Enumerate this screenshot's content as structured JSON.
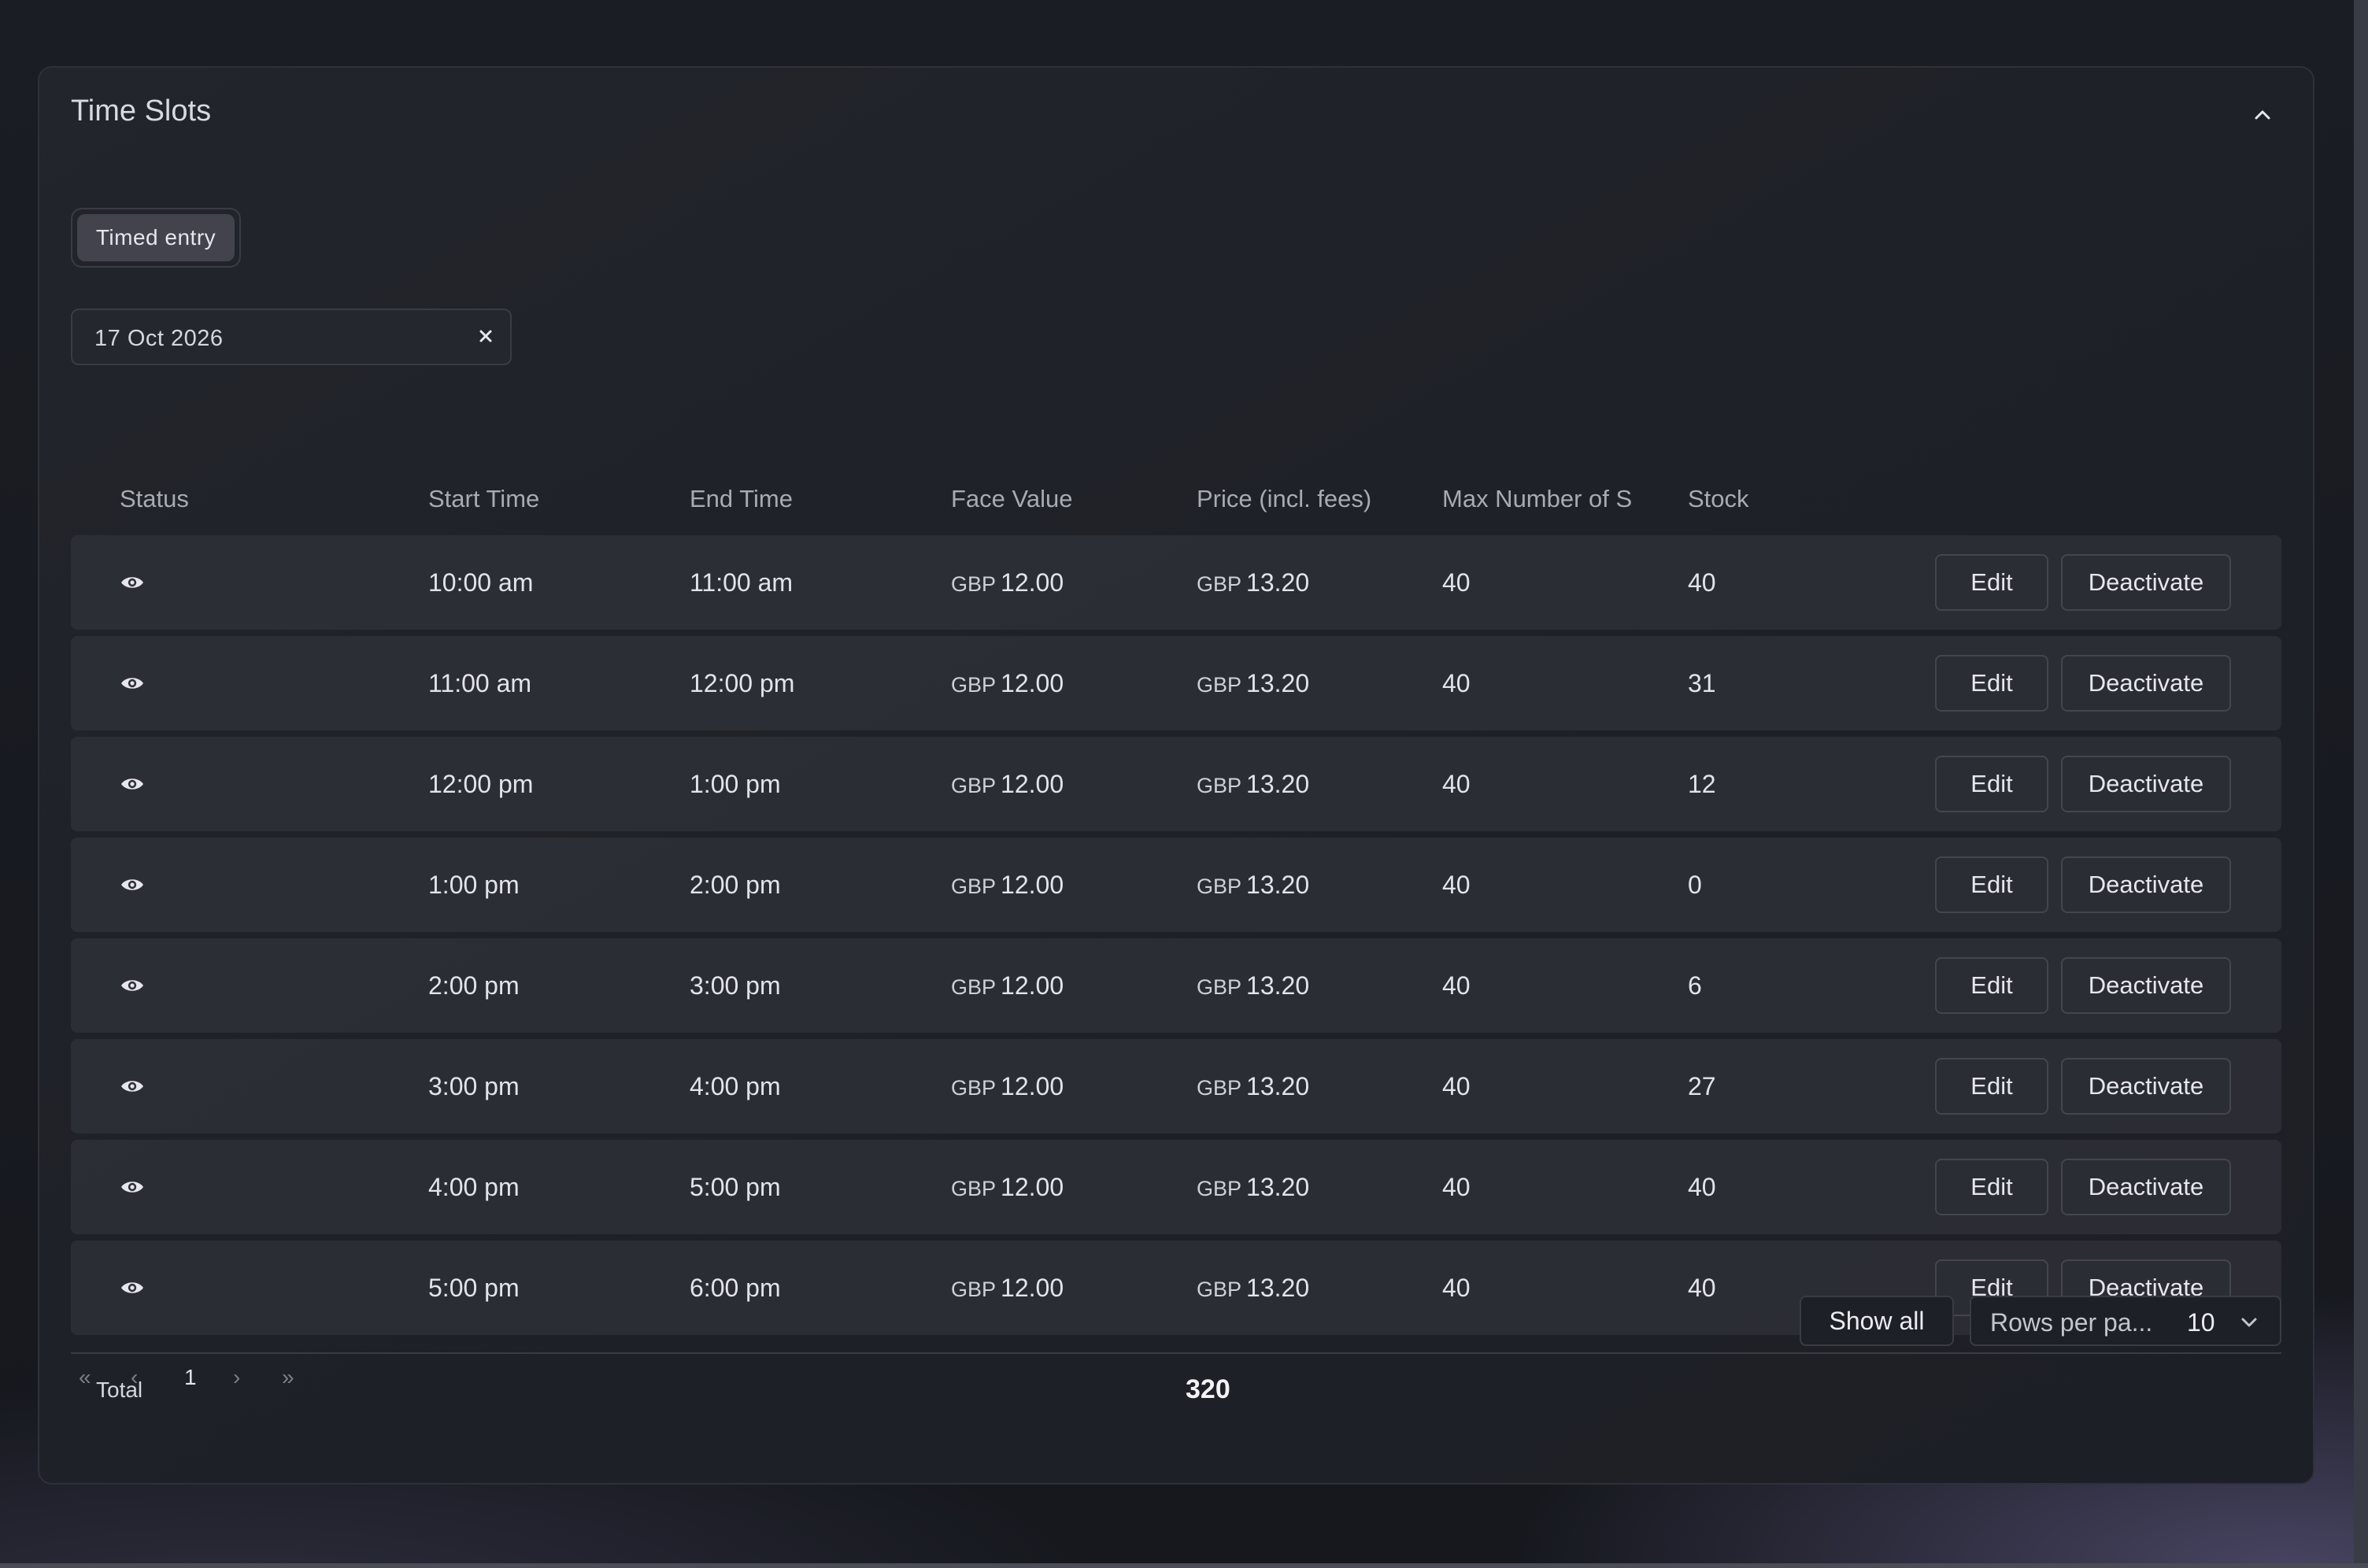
{
  "panel": {
    "title": "Time Slots"
  },
  "filter_chip": "Timed entry",
  "date_filter": {
    "value": "17 Oct 2026"
  },
  "table": {
    "columns": [
      "Status",
      "Start Time",
      "End Time",
      "Face Value",
      "Price (incl. fees)",
      "Max Number of S",
      "Stock"
    ],
    "rows": [
      {
        "status_icon": "eye-icon",
        "start": "10:00 am",
        "end": "11:00 am",
        "face_currency": "GBP",
        "face_amount": "12.00",
        "price_currency": "GBP",
        "price_amount": "13.20",
        "max": "40",
        "stock": "40",
        "edit": "Edit",
        "deactivate": "Deactivate"
      },
      {
        "status_icon": "eye-icon",
        "start": "11:00 am",
        "end": "12:00 pm",
        "face_currency": "GBP",
        "face_amount": "12.00",
        "price_currency": "GBP",
        "price_amount": "13.20",
        "max": "40",
        "stock": "31",
        "edit": "Edit",
        "deactivate": "Deactivate"
      },
      {
        "status_icon": "eye-icon",
        "start": "12:00 pm",
        "end": "1:00 pm",
        "face_currency": "GBP",
        "face_amount": "12.00",
        "price_currency": "GBP",
        "price_amount": "13.20",
        "max": "40",
        "stock": "12",
        "edit": "Edit",
        "deactivate": "Deactivate"
      },
      {
        "status_icon": "eye-icon",
        "start": "1:00 pm",
        "end": "2:00 pm",
        "face_currency": "GBP",
        "face_amount": "12.00",
        "price_currency": "GBP",
        "price_amount": "13.20",
        "max": "40",
        "stock": "0",
        "edit": "Edit",
        "deactivate": "Deactivate"
      },
      {
        "status_icon": "eye-icon",
        "start": "2:00 pm",
        "end": "3:00 pm",
        "face_currency": "GBP",
        "face_amount": "12.00",
        "price_currency": "GBP",
        "price_amount": "13.20",
        "max": "40",
        "stock": "6",
        "edit": "Edit",
        "deactivate": "Deactivate"
      },
      {
        "status_icon": "eye-icon",
        "start": "3:00 pm",
        "end": "4:00 pm",
        "face_currency": "GBP",
        "face_amount": "12.00",
        "price_currency": "GBP",
        "price_amount": "13.20",
        "max": "40",
        "stock": "27",
        "edit": "Edit",
        "deactivate": "Deactivate"
      },
      {
        "status_icon": "eye-icon",
        "start": "4:00 pm",
        "end": "5:00 pm",
        "face_currency": "GBP",
        "face_amount": "12.00",
        "price_currency": "GBP",
        "price_amount": "13.20",
        "max": "40",
        "stock": "40",
        "edit": "Edit",
        "deactivate": "Deactivate"
      },
      {
        "status_icon": "eye-icon",
        "start": "5:00 pm",
        "end": "6:00 pm",
        "face_currency": "GBP",
        "face_amount": "12.00",
        "price_currency": "GBP",
        "price_amount": "13.20",
        "max": "40",
        "stock": "40",
        "edit": "Edit",
        "deactivate": "Deactivate"
      }
    ]
  },
  "pagination": {
    "first": "«",
    "prev": "‹",
    "current_page": "1",
    "next": "›",
    "last": "»"
  },
  "show_all_label": "Show all",
  "rows_per_page": {
    "label": "Rows per pa...",
    "value": "10"
  },
  "total": {
    "label": "Total",
    "value": "320"
  },
  "icons": [
    "chevron-up-icon",
    "close-icon",
    "eye-icon",
    "chevron-down-icon"
  ],
  "colors": {
    "background": "#16181e",
    "panel": "#1f2128",
    "row": "#2f3138",
    "button": "#2b2d34",
    "chip": "#42434d",
    "text": "#e3e4ea",
    "muted_text": "#a8aab4"
  }
}
